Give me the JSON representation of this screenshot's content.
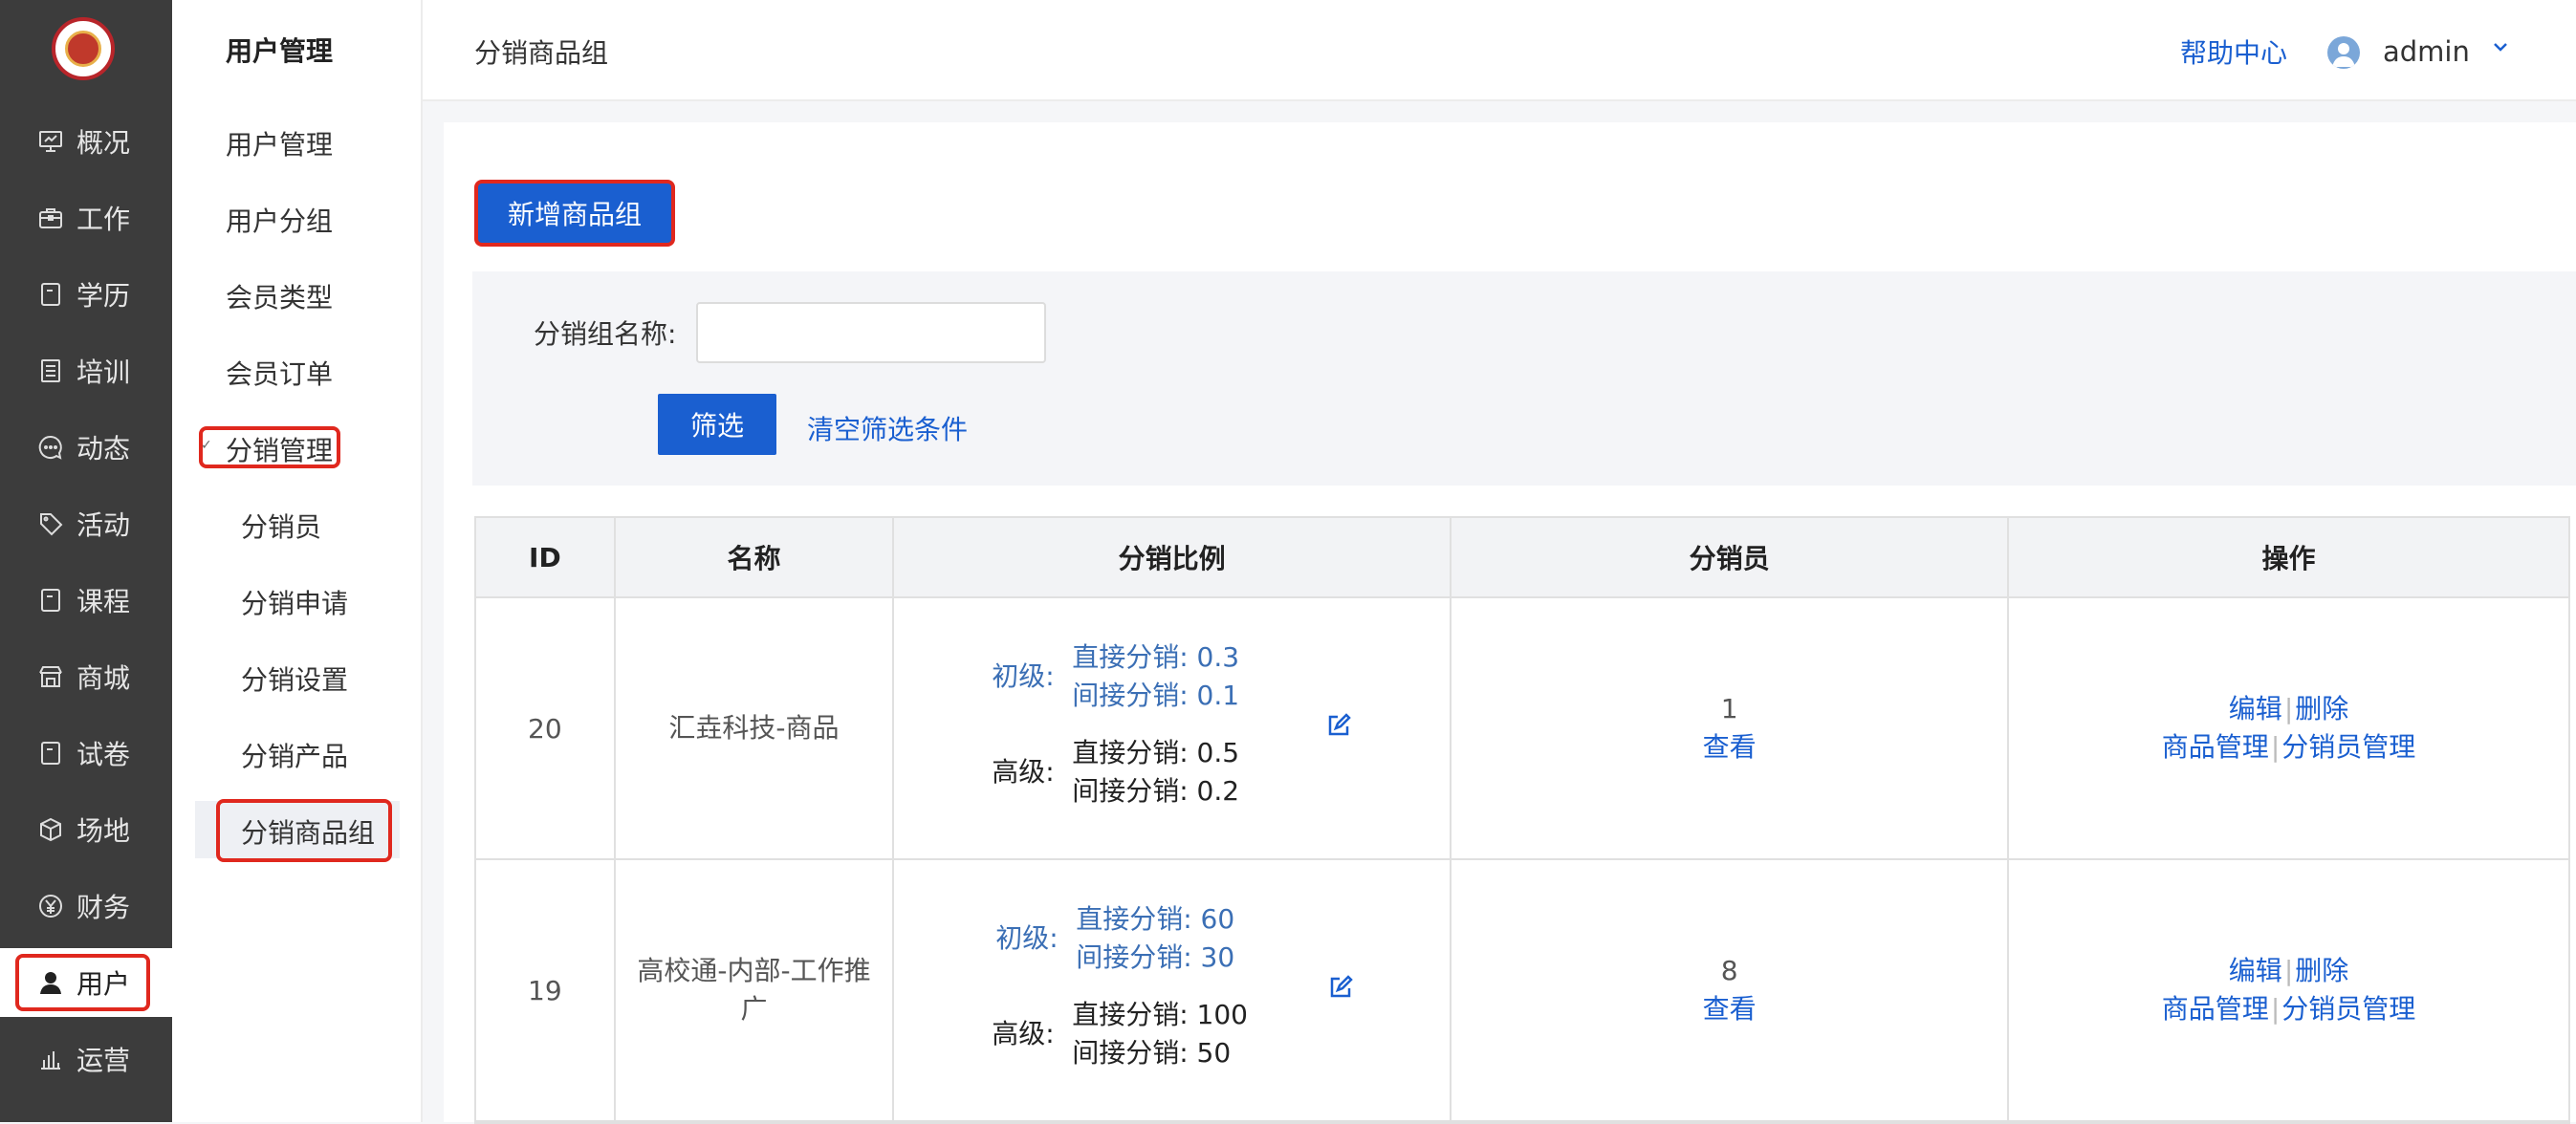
{
  "rail": {
    "items": [
      {
        "label": "概况",
        "icon": "dashboard-icon"
      },
      {
        "label": "工作",
        "icon": "briefcase-icon"
      },
      {
        "label": "学历",
        "icon": "document-icon"
      },
      {
        "label": "培训",
        "icon": "list-icon"
      },
      {
        "label": "动态",
        "icon": "chat-icon"
      },
      {
        "label": "活动",
        "icon": "tag-icon"
      },
      {
        "label": "课程",
        "icon": "document-icon"
      },
      {
        "label": "商城",
        "icon": "shop-icon"
      },
      {
        "label": "试卷",
        "icon": "document-icon"
      },
      {
        "label": "场地",
        "icon": "box-icon"
      },
      {
        "label": "财务",
        "icon": "yen-icon"
      },
      {
        "label": "用户",
        "icon": "user-icon"
      },
      {
        "label": "运营",
        "icon": "bar-chart-icon"
      }
    ]
  },
  "sidebar": {
    "title": "用户管理",
    "items": [
      "用户管理",
      "用户分组",
      "会员类型",
      "会员订单"
    ],
    "group": "分销管理",
    "children": [
      "分销员",
      "分销申请",
      "分销设置",
      "分销产品",
      "分销商品组"
    ]
  },
  "header": {
    "title": "分销商品组",
    "help": "帮助中心",
    "username": "admin"
  },
  "toolbar": {
    "add_label": "新增商品组"
  },
  "filter": {
    "name_label": "分销组名称:",
    "name_value": "",
    "submit_label": "筛选",
    "clear_label": "清空筛选条件"
  },
  "table": {
    "headers": [
      "ID",
      "名称",
      "分销比例",
      "分销员",
      "操作"
    ],
    "rows": [
      {
        "id": "20",
        "name": "汇垚科技-商品",
        "basic_label": "初级:",
        "basic_direct": "直接分销: 0.3",
        "basic_indirect": "间接分销: 0.1",
        "advanced_label": "高级:",
        "advanced_direct": "直接分销: 0.5",
        "advanced_indirect": "间接分销: 0.2",
        "member_count": "1",
        "view_label": "查看",
        "edit_label": "编辑",
        "delete_label": "删除",
        "goods_label": "商品管理",
        "members_label": "分销员管理"
      },
      {
        "id": "19",
        "name": "高校通-内部-工作推广",
        "basic_label": "初级:",
        "basic_direct": "直接分销: 60",
        "basic_indirect": "间接分销: 30",
        "advanced_label": "高级:",
        "advanced_direct": "直接分销: 100",
        "advanced_indirect": "间接分销: 50",
        "member_count": "8",
        "view_label": "查看",
        "edit_label": "编辑",
        "delete_label": "删除",
        "goods_label": "商品管理",
        "members_label": "分销员管理"
      }
    ]
  }
}
